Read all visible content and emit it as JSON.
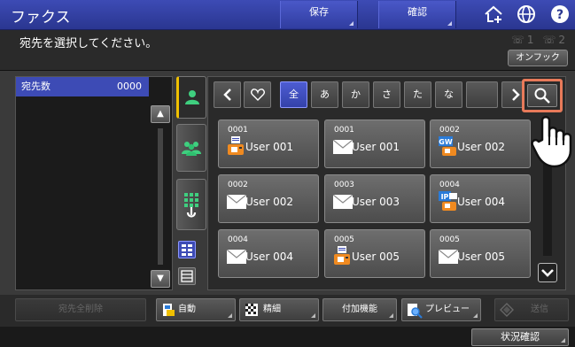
{
  "header": {
    "title": "ファクス",
    "save_label": "保存",
    "confirm_label": "確認",
    "icons": [
      "home-plus-icon",
      "globe-icon",
      "help-icon"
    ]
  },
  "message": "宛先を選択してください。",
  "line_indicators": "☏1 ☏2",
  "onhook_label": "オンフック",
  "destinations": {
    "label": "宛先数",
    "count": "0000"
  },
  "filter_tabs": [
    "♡",
    "全",
    "あ",
    "か",
    "さ",
    "た",
    "な"
  ],
  "active_filter": "全",
  "entries": [
    {
      "number": "0001",
      "name": "User 001",
      "type": "fax"
    },
    {
      "number": "0001",
      "name": "User 001",
      "type": "email"
    },
    {
      "number": "0002",
      "name": "User 002",
      "type": "gw-fax"
    },
    {
      "number": "0002",
      "name": "User 002",
      "type": "email"
    },
    {
      "number": "0003",
      "name": "User 003",
      "type": "email"
    },
    {
      "number": "0004",
      "name": "User 004",
      "type": "ip-fax"
    },
    {
      "number": "0004",
      "name": "User 004",
      "type": "email"
    },
    {
      "number": "0005",
      "name": "User 005",
      "type": "fax"
    },
    {
      "number": "0005",
      "name": "User 005",
      "type": "email"
    }
  ],
  "actions": {
    "clear_all": "宛先全削除",
    "auto": "自動",
    "fine": "精細",
    "add_functions": "付加機能",
    "preview": "プレビュー",
    "send": "送信"
  },
  "status_label": "状況確認",
  "colors": {
    "accent": "#3d4bb5",
    "highlight": "#e87a5a",
    "selected_tab_marker": "#f0c000"
  }
}
